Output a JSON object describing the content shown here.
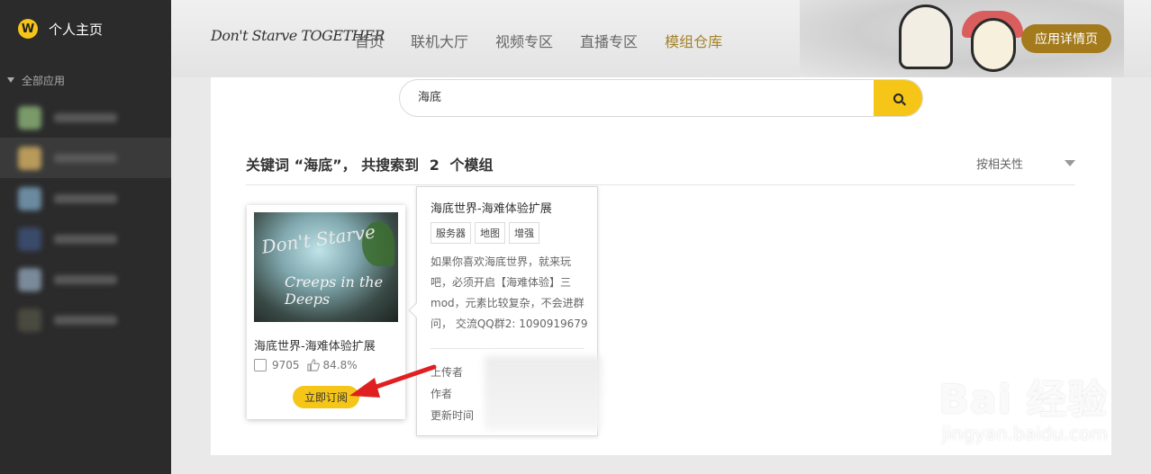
{
  "sidebar": {
    "title": "个人主页",
    "logo_letter": "W",
    "group_label": "全部应用",
    "items": [
      {
        "color": "#7a9a6a"
      },
      {
        "color": "#b89a5a"
      },
      {
        "color": "#6a8aa0"
      },
      {
        "color": "#3a4a6a"
      },
      {
        "color": "#7a8a9a"
      },
      {
        "color": "#4a4a40"
      }
    ]
  },
  "header": {
    "game_logo": "Don't Starve TOGETHER",
    "nav": [
      {
        "label": "首页"
      },
      {
        "label": "联机大厅"
      },
      {
        "label": "视频专区"
      },
      {
        "label": "直播专区"
      },
      {
        "label": "模组仓库"
      }
    ],
    "detail_button": "应用详情页"
  },
  "search": {
    "value": "海底"
  },
  "results": {
    "prefix": "关键词 “海底”， 共搜索到",
    "count": "2",
    "suffix": "个模组",
    "sort_label": "按相关性"
  },
  "card": {
    "thumb_line1": "Don't Starve",
    "thumb_line2": "Creeps in the Deeps",
    "title": "海底世界-海难体验扩展",
    "subscriptions": "9705",
    "rating": "84.8%",
    "subscribe_button": "立即订阅"
  },
  "popup": {
    "title": "海底世界-海难体验扩展",
    "tags": [
      "服务器",
      "地图",
      "增强"
    ],
    "description": "如果你喜欢海底世界，就来玩吧，必须开启【海难体验】三mod，元素比较复杂，不会进群问， 交流QQ群2: 1090919679",
    "uploader_label": "上传者",
    "author_label": "作者",
    "updated_label": "更新时间"
  },
  "watermark": {
    "brand": "Bai 经验",
    "url": "jingyan.baidu.com"
  },
  "colors": {
    "accent": "#a37a1c",
    "yellow": "#f5c518",
    "sidebar_bg": "#2b2b2c",
    "arrow": "#e02020"
  }
}
